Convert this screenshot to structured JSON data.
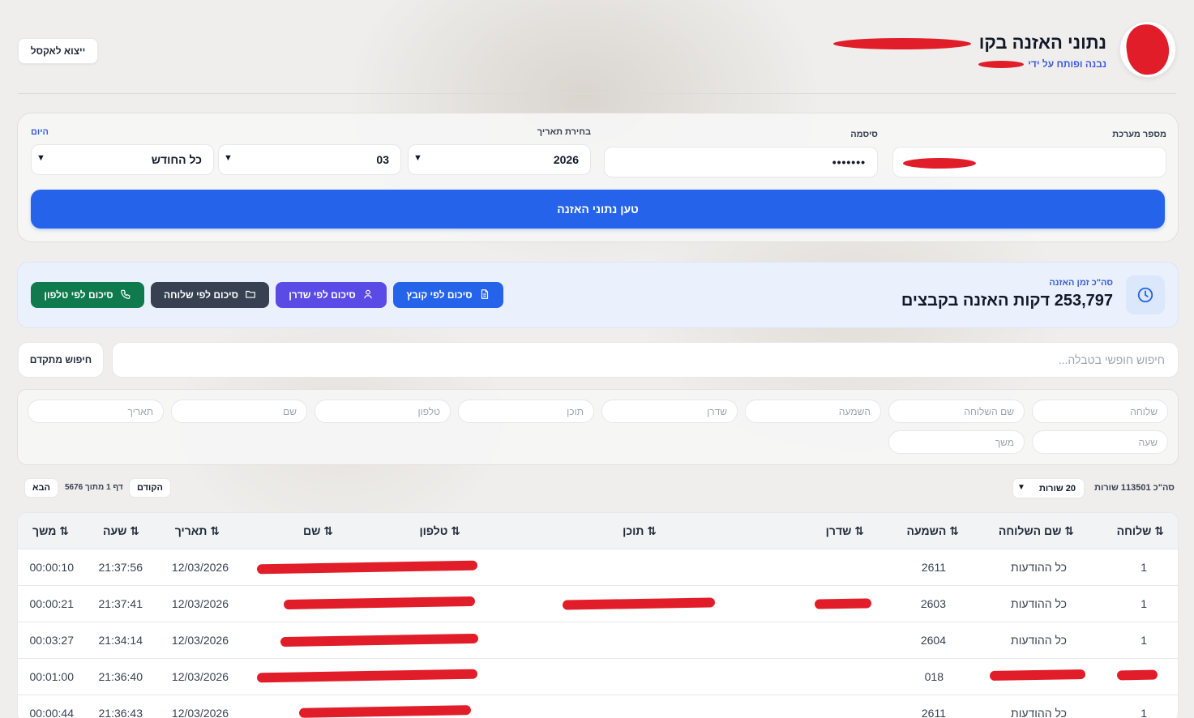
{
  "header": {
    "title": "נתוני האזנה בקו",
    "subtitle": "נבנה ופותח על ידי",
    "export_label": "ייצוא לאקסל"
  },
  "form": {
    "system_label": "מספר מערכת",
    "system_value": "",
    "password_label": "סיסמה",
    "password_value": "•••••••",
    "date_label": "בחירת תאריך",
    "year": "2026",
    "month": "03",
    "day_label": "היום",
    "day_value": "כל החודש",
    "load_button": "טען נתוני האזנה"
  },
  "summary": {
    "label": "סה\"כ זמן האזנה",
    "value": "253,797 דקות האזנה בקבצים",
    "buttons": [
      {
        "label": "סיכום לפי קובץ",
        "icon": "file-icon",
        "color": "#2563eb"
      },
      {
        "label": "סיכום לפי שדרן",
        "icon": "user-icon",
        "color": "#5b4be6"
      },
      {
        "label": "סיכום לפי שלוחה",
        "icon": "folder-icon",
        "color": "#374151"
      },
      {
        "label": "סיכום לפי טלפון",
        "icon": "phone-icon",
        "color": "#0f7a4d"
      }
    ]
  },
  "search": {
    "placeholder": "חיפוש חופשי בטבלה...",
    "advanced": "חיפוש מתקדם"
  },
  "filters": {
    "row1": [
      "שלוחה",
      "שם השלוחה",
      "השמעה",
      "שדרן",
      "תוכן",
      "טלפון",
      "שם",
      "תאריך"
    ],
    "row2": [
      "שעה",
      "משך"
    ]
  },
  "pagination": {
    "total": "סה\"כ 113501 שורות",
    "rows_per_page": "20 שורות",
    "prev": "הקודם",
    "page_info": "דף 1 מתוך 5676",
    "next": "הבא"
  },
  "table": {
    "sort_icon": "⇅",
    "columns": [
      "שלוחה",
      "שם השלוחה",
      "השמעה",
      "שדרן",
      "תוכן",
      "טלפון",
      "שם",
      "תאריך",
      "שעה",
      "משך"
    ],
    "rows": [
      {
        "ext": "1",
        "ext_name": "כל ההודעות",
        "play": "2611",
        "date": "12/03/2026",
        "time": "21:37:56",
        "dur": "00:00:10"
      },
      {
        "ext": "1",
        "ext_name": "כל ההודעות",
        "play": "2603",
        "date": "12/03/2026",
        "time": "21:37:41",
        "dur": "00:00:21"
      },
      {
        "ext": "1",
        "ext_name": "כל ההודעות",
        "play": "2604",
        "date": "12/03/2026",
        "time": "21:34:14",
        "dur": "00:03:27"
      },
      {
        "ext": "",
        "ext_name": "",
        "play": "018",
        "date": "12/03/2026",
        "time": "21:36:40",
        "dur": "00:01:00"
      },
      {
        "ext": "1",
        "ext_name": "כל ההודעות",
        "play": "2611",
        "date": "12/03/2026",
        "time": "21:36:43",
        "dur": "00:00:44"
      }
    ]
  },
  "colors": {
    "primary": "#2563eb",
    "indigo": "#5b4be6",
    "slate": "#374151",
    "green": "#0f7a4d",
    "redaction": "#e11d2a"
  }
}
